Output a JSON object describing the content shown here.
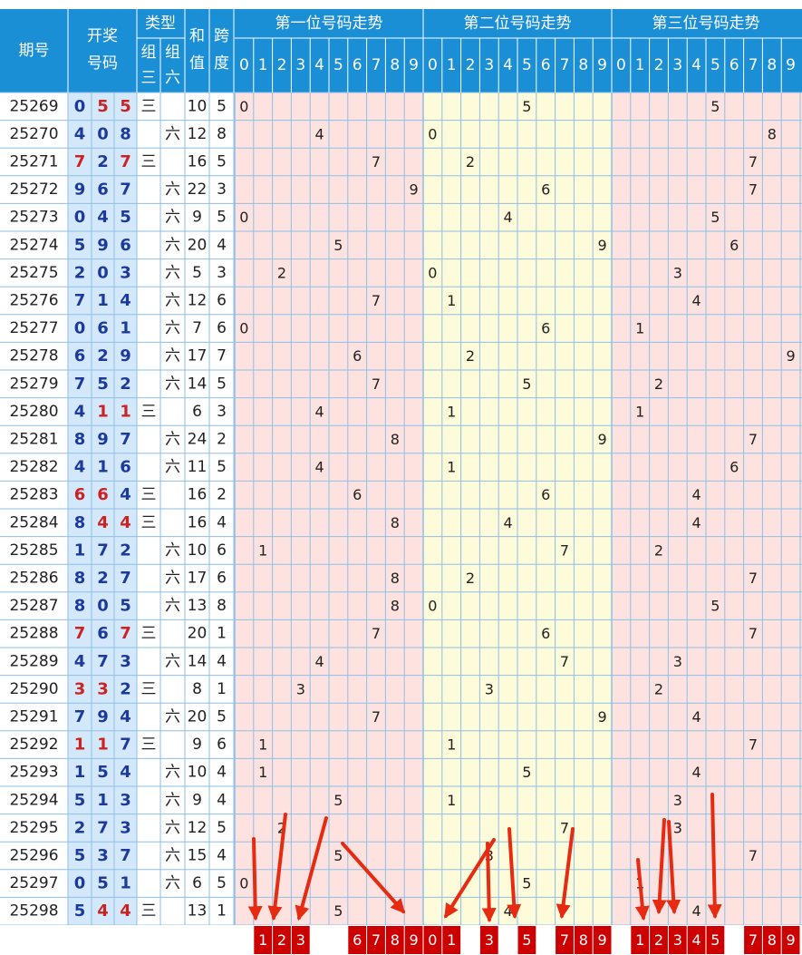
{
  "header": {
    "issue": "期号",
    "draw_number": [
      "开奖",
      "号码"
    ],
    "type": "类型",
    "group3": [
      "组",
      "三"
    ],
    "group6": [
      "组",
      "六"
    ],
    "sum": [
      "和",
      "值"
    ],
    "span": [
      "跨",
      "度"
    ],
    "sections": [
      "第一位号码走势",
      "第二位号码走势",
      "第三位号码走势"
    ],
    "digits": [
      "0",
      "1",
      "2",
      "3",
      "4",
      "5",
      "6",
      "7",
      "8",
      "9"
    ]
  },
  "type_labels": {
    "group3": "三",
    "group6": "六"
  },
  "colors": {
    "header_bg": "#1a8fd6",
    "section1_bg": "#fde2e0",
    "section2_bg": "#fdfbd9",
    "section3_bg": "#fde2e0",
    "draw_bg": "#d3e8fb",
    "digit_blue": "#1c3a9c",
    "digit_red": "#cc2222",
    "selected_box": "#cc0000",
    "arrow": "#e62b12"
  },
  "rows": [
    {
      "issue": "25269",
      "d": [
        0,
        5,
        5
      ],
      "type": "g3",
      "sum": 10,
      "span": 5
    },
    {
      "issue": "25270",
      "d": [
        4,
        0,
        8
      ],
      "type": "g6",
      "sum": 12,
      "span": 8
    },
    {
      "issue": "25271",
      "d": [
        7,
        2,
        7
      ],
      "type": "g3",
      "sum": 16,
      "span": 5
    },
    {
      "issue": "25272",
      "d": [
        9,
        6,
        7
      ],
      "type": "g6",
      "sum": 22,
      "span": 3
    },
    {
      "issue": "25273",
      "d": [
        0,
        4,
        5
      ],
      "type": "g6",
      "sum": 9,
      "span": 5
    },
    {
      "issue": "25274",
      "d": [
        5,
        9,
        6
      ],
      "type": "g6",
      "sum": 20,
      "span": 4
    },
    {
      "issue": "25275",
      "d": [
        2,
        0,
        3
      ],
      "type": "g6",
      "sum": 5,
      "span": 3
    },
    {
      "issue": "25276",
      "d": [
        7,
        1,
        4
      ],
      "type": "g6",
      "sum": 12,
      "span": 6
    },
    {
      "issue": "25277",
      "d": [
        0,
        6,
        1
      ],
      "type": "g6",
      "sum": 7,
      "span": 6
    },
    {
      "issue": "25278",
      "d": [
        6,
        2,
        9
      ],
      "type": "g6",
      "sum": 17,
      "span": 7
    },
    {
      "issue": "25279",
      "d": [
        7,
        5,
        2
      ],
      "type": "g6",
      "sum": 14,
      "span": 5
    },
    {
      "issue": "25280",
      "d": [
        4,
        1,
        1
      ],
      "type": "g3",
      "sum": 6,
      "span": 3
    },
    {
      "issue": "25281",
      "d": [
        8,
        9,
        7
      ],
      "type": "g6",
      "sum": 24,
      "span": 2
    },
    {
      "issue": "25282",
      "d": [
        4,
        1,
        6
      ],
      "type": "g6",
      "sum": 11,
      "span": 5
    },
    {
      "issue": "25283",
      "d": [
        6,
        6,
        4
      ],
      "type": "g3",
      "sum": 16,
      "span": 2
    },
    {
      "issue": "25284",
      "d": [
        8,
        4,
        4
      ],
      "type": "g3",
      "sum": 16,
      "span": 4
    },
    {
      "issue": "25285",
      "d": [
        1,
        7,
        2
      ],
      "type": "g6",
      "sum": 10,
      "span": 6
    },
    {
      "issue": "25286",
      "d": [
        8,
        2,
        7
      ],
      "type": "g6",
      "sum": 17,
      "span": 6
    },
    {
      "issue": "25287",
      "d": [
        8,
        0,
        5
      ],
      "type": "g6",
      "sum": 13,
      "span": 8
    },
    {
      "issue": "25288",
      "d": [
        7,
        6,
        7
      ],
      "type": "g3",
      "sum": 20,
      "span": 1
    },
    {
      "issue": "25289",
      "d": [
        4,
        7,
        3
      ],
      "type": "g6",
      "sum": 14,
      "span": 4
    },
    {
      "issue": "25290",
      "d": [
        3,
        3,
        2
      ],
      "type": "g3",
      "sum": 8,
      "span": 1
    },
    {
      "issue": "25291",
      "d": [
        7,
        9,
        4
      ],
      "type": "g6",
      "sum": 20,
      "span": 5
    },
    {
      "issue": "25292",
      "d": [
        1,
        1,
        7
      ],
      "type": "g3",
      "sum": 9,
      "span": 6
    },
    {
      "issue": "25293",
      "d": [
        1,
        5,
        4
      ],
      "type": "g6",
      "sum": 10,
      "span": 4
    },
    {
      "issue": "25294",
      "d": [
        5,
        1,
        3
      ],
      "type": "g6",
      "sum": 9,
      "span": 4
    },
    {
      "issue": "25295",
      "d": [
        2,
        7,
        3
      ],
      "type": "g6",
      "sum": 12,
      "span": 5
    },
    {
      "issue": "25296",
      "d": [
        5,
        3,
        7
      ],
      "type": "g6",
      "sum": 15,
      "span": 4
    },
    {
      "issue": "25297",
      "d": [
        0,
        5,
        1
      ],
      "type": "g6",
      "sum": 6,
      "span": 5
    },
    {
      "issue": "25298",
      "d": [
        5,
        4,
        4
      ],
      "type": "g3",
      "sum": 13,
      "span": 1
    }
  ],
  "selection": [
    [
      1,
      2,
      3,
      6,
      7,
      8,
      9
    ],
    [
      0,
      1,
      3,
      5,
      7,
      8,
      9
    ],
    [
      1,
      2,
      3,
      4,
      5,
      7,
      8,
      9
    ]
  ]
}
